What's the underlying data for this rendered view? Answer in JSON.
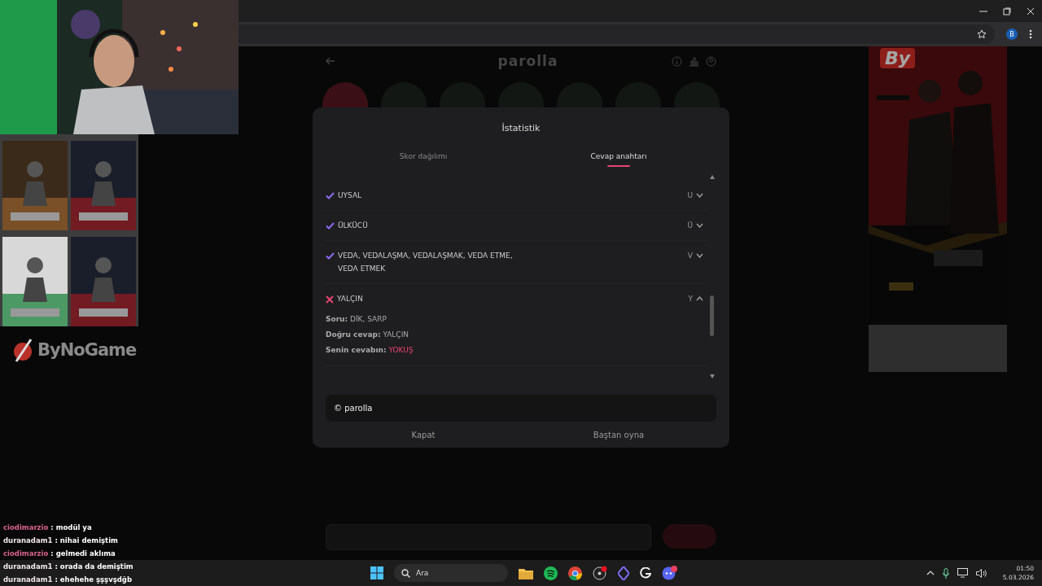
{
  "browser": {
    "profile_initial": "B"
  },
  "page": {
    "logo": "parolla"
  },
  "modal": {
    "title": "İstatistik",
    "tabs": [
      {
        "label": "Skor dağılımı",
        "selected": false
      },
      {
        "label": "Cevap anahtarı",
        "selected": true
      }
    ],
    "answers": [
      {
        "answer": "UYSAL",
        "letter": "U",
        "correct": true,
        "expanded": false
      },
      {
        "answer": "ÜLKÜCÜ",
        "letter": "Ü",
        "correct": true,
        "expanded": false
      },
      {
        "answer": "VEDA, VEDALAŞMA, VEDALAŞMAK, VEDA ETME, VEDA ETMEK",
        "letter": "V",
        "correct": true,
        "expanded": false
      },
      {
        "answer": "YALÇIN",
        "letter": "Y",
        "correct": false,
        "expanded": true,
        "details": [
          {
            "label": "Soru:",
            "value": "DİK, SARP",
            "kind": "plain"
          },
          {
            "label": "Doğru cevap:",
            "value": "YALÇIN",
            "kind": "plain"
          },
          {
            "label": "Senin cevabın:",
            "value": "YOKUŞ",
            "kind": "wrong"
          }
        ]
      }
    ],
    "footer": "© parolla",
    "buttons": [
      "Kapat",
      "Baştan oyna"
    ]
  },
  "sponsor_logo": "ByNoGame",
  "ad_overlay_logo": "By",
  "chat": [
    {
      "user": "ciodimarzio",
      "message": ": modül ya",
      "color": "#d9628f"
    },
    {
      "user": "duranadam1",
      "message": ": nihai demiştim",
      "color": "#f0e6ea"
    },
    {
      "user": "ciodimarzio",
      "message": ": gelmedi aklıma",
      "color": "#d9628f"
    },
    {
      "user": "duranadam1",
      "message": ": orada da demiştim",
      "color": "#f0e6ea"
    },
    {
      "user": "duranadam1",
      "message": ": ehehehe şşşvşdğb",
      "color": "#f0e6ea"
    }
  ],
  "taskbar": {
    "search_placeholder": "Ara",
    "time": "01:50",
    "date": "5.03.2026"
  }
}
